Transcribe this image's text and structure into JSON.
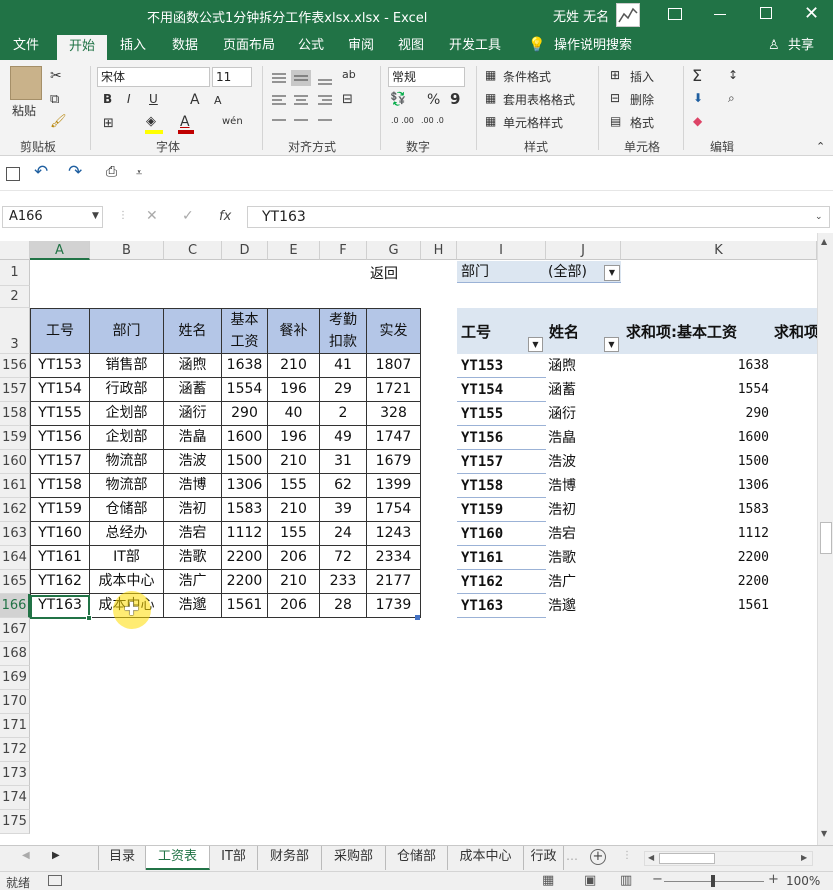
{
  "window": {
    "title": "不用函数公式1分钟拆分工作表xlsx.xlsx  -  Excel",
    "user": "无姓 无名"
  },
  "ribbon_tabs": [
    "文件",
    "开始",
    "插入",
    "数据",
    "页面布局",
    "公式",
    "审阅",
    "视图",
    "开发工具"
  ],
  "tell_me": "操作说明搜索",
  "share": "共享",
  "clipboard": {
    "paste": "粘贴",
    "group": "剪贴板"
  },
  "font": {
    "name": "宋体",
    "size": "11",
    "bold": "B",
    "italic": "I",
    "underline": "U",
    "grow": "A",
    "shrink": "A",
    "wen": "wén",
    "font_color": "A",
    "group": "字体"
  },
  "alignment": {
    "group": "对齐方式",
    "wrap": "ab"
  },
  "number": {
    "format": "常规",
    "percent": "%",
    "comma": "9",
    "inc": ".0 .00",
    "dec": ".00 .0",
    "group": "数字"
  },
  "styles": {
    "cond": "条件格式",
    "table": "套用表格格式",
    "cell": "单元格样式",
    "group": "样式"
  },
  "cells": {
    "insert": "插入",
    "delete": "删除",
    "format": "格式",
    "group": "单元格"
  },
  "editing": {
    "group": "编辑"
  },
  "formula_bar": {
    "name_box": "A166",
    "fx": "fx",
    "content": "YT163"
  },
  "columns": [
    "A",
    "B",
    "C",
    "D",
    "E",
    "F",
    "G",
    "H",
    "I",
    "J",
    "K"
  ],
  "row_labels": [
    "1",
    "2",
    "3",
    "156",
    "157",
    "158",
    "159",
    "160",
    "161",
    "162",
    "163",
    "164",
    "165",
    "166",
    "167",
    "168",
    "169",
    "170",
    "171",
    "172",
    "173",
    "174",
    "175"
  ],
  "return_link": "返回",
  "table": {
    "headers": [
      "工号",
      "部门",
      "姓名",
      "基本\n工资",
      "餐补",
      "考勤\n扣款",
      "实发"
    ],
    "rows": [
      [
        "YT153",
        "销售部",
        "涵煦",
        "1638",
        "210",
        "41",
        "1807"
      ],
      [
        "YT154",
        "行政部",
        "涵蓄",
        "1554",
        "196",
        "29",
        "1721"
      ],
      [
        "YT155",
        "企划部",
        "涵衍",
        "290",
        "40",
        "2",
        "328"
      ],
      [
        "YT156",
        "企划部",
        "浩皛",
        "1600",
        "196",
        "49",
        "1747"
      ],
      [
        "YT157",
        "物流部",
        "浩波",
        "1500",
        "210",
        "31",
        "1679"
      ],
      [
        "YT158",
        "物流部",
        "浩博",
        "1306",
        "155",
        "62",
        "1399"
      ],
      [
        "YT159",
        "仓储部",
        "浩初",
        "1583",
        "210",
        "39",
        "1754"
      ],
      [
        "YT160",
        "总经办",
        "浩宕",
        "1112",
        "155",
        "24",
        "1243"
      ],
      [
        "YT161",
        "IT部",
        "浩歌",
        "2200",
        "206",
        "72",
        "2334"
      ],
      [
        "YT162",
        "成本中心",
        "浩广",
        "2200",
        "210",
        "233",
        "2177"
      ],
      [
        "YT163",
        "成本中心",
        "浩邈",
        "1561",
        "206",
        "28",
        "1739"
      ]
    ]
  },
  "pivot": {
    "filter_label": "部门",
    "filter_value": "(全部)",
    "headers": [
      "工号",
      "姓名",
      "求和项:基本工资",
      "求和项"
    ],
    "rows": [
      [
        "YT153",
        "涵煦",
        "1638"
      ],
      [
        "YT154",
        "涵蓄",
        "1554"
      ],
      [
        "YT155",
        "涵衍",
        "290"
      ],
      [
        "YT156",
        "浩皛",
        "1600"
      ],
      [
        "YT157",
        "浩波",
        "1500"
      ],
      [
        "YT158",
        "浩博",
        "1306"
      ],
      [
        "YT159",
        "浩初",
        "1583"
      ],
      [
        "YT160",
        "浩宕",
        "1112"
      ],
      [
        "YT161",
        "浩歌",
        "2200"
      ],
      [
        "YT162",
        "浩广",
        "2200"
      ],
      [
        "YT163",
        "浩邈",
        "1561"
      ]
    ]
  },
  "sheet_tabs": [
    "目录",
    "工资表",
    "IT部",
    "财务部",
    "采购部",
    "仓储部",
    "成本中心",
    "行政"
  ],
  "status": {
    "ready": "就绪",
    "zoom": "100%"
  }
}
